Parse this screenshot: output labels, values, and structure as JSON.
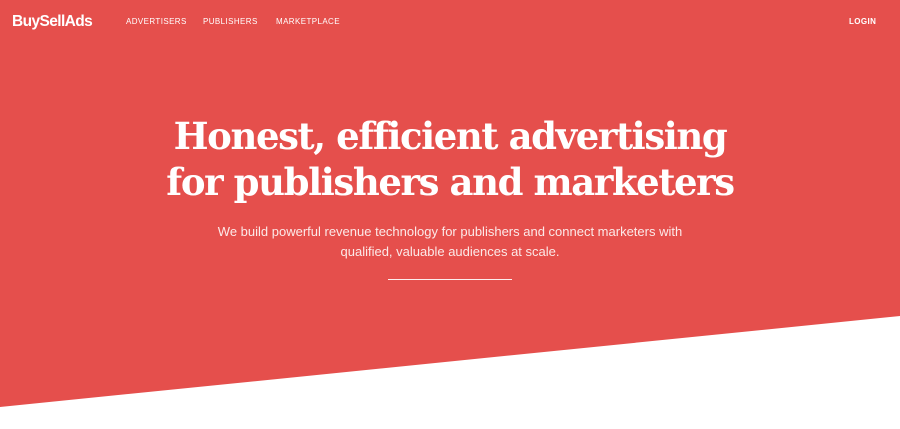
{
  "brand": {
    "logo_text": "BuySellAds",
    "accent_color": "#e54f4c",
    "background_color": "#ffffff"
  },
  "nav": {
    "advertisers": "ADVERTISERS",
    "publishers": "PUBLISHERS",
    "marketplace": "MARKETPLACE",
    "login": "LOGIN"
  },
  "hero": {
    "headline_line1": "Honest, efficient advertising",
    "headline_line2": "for publishers and marketers",
    "subtitle_line1": "We build powerful revenue technology for publishers and connect marketers with",
    "subtitle_line2": "qualified, valuable audiences at scale."
  }
}
